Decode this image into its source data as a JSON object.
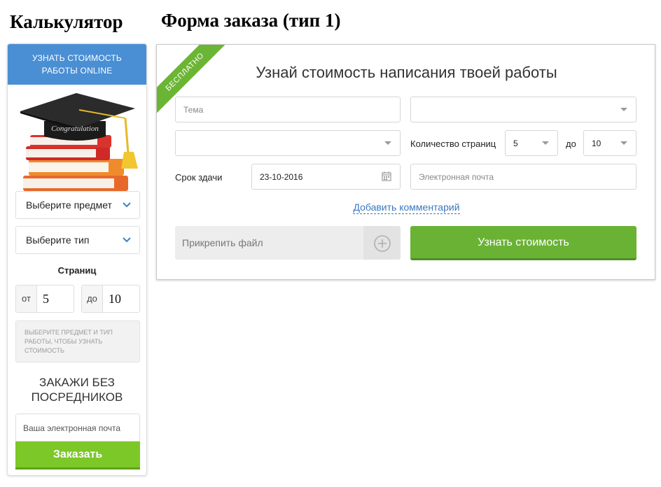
{
  "headings": {
    "calculator": "Калькулятор",
    "order_form": "Форма заказа (тип 1)"
  },
  "calculator": {
    "header_line1": "УЗНАТЬ СТОИМОСТЬ",
    "header_line2": "РАБОТЫ ONLINE",
    "cap_text": "Congratulation",
    "subject_select": "Выберите предмет",
    "type_select": "Выберите тип",
    "pages_label": "Страниц",
    "from_prefix": "от",
    "from_value": "5",
    "to_prefix": "до",
    "to_value": "10",
    "note": "Выберите предмет и тип работы, чтобы узнать стоимость",
    "no_mid_line1": "ЗАКАЖИ БЕЗ",
    "no_mid_line2": "ПОСРЕДНИКОВ",
    "email_placeholder": "Ваша электронная почта",
    "order_button": "Заказать",
    "colors": {
      "header": "#4a8fd4",
      "button": "#7cc828"
    }
  },
  "form": {
    "ribbon": "БЕСПЛАТНО",
    "title": "Узнай стоимость написания твоей работы",
    "topic_placeholder": "Тема",
    "pages_label": "Количество страниц",
    "pages_from": "5",
    "pages_to_label": "до",
    "pages_to": "10",
    "deadline_label": "Срок здачи",
    "deadline_value": "23-10-2016",
    "email_placeholder": "Электронная почта",
    "add_comment": "Добавить комментарий",
    "attach_file": "Прикрепить файл",
    "submit": "Узнать стоимость",
    "colors": {
      "ribbon": "#6bb534",
      "submit": "#6ab234",
      "link": "#3a78c0"
    }
  }
}
